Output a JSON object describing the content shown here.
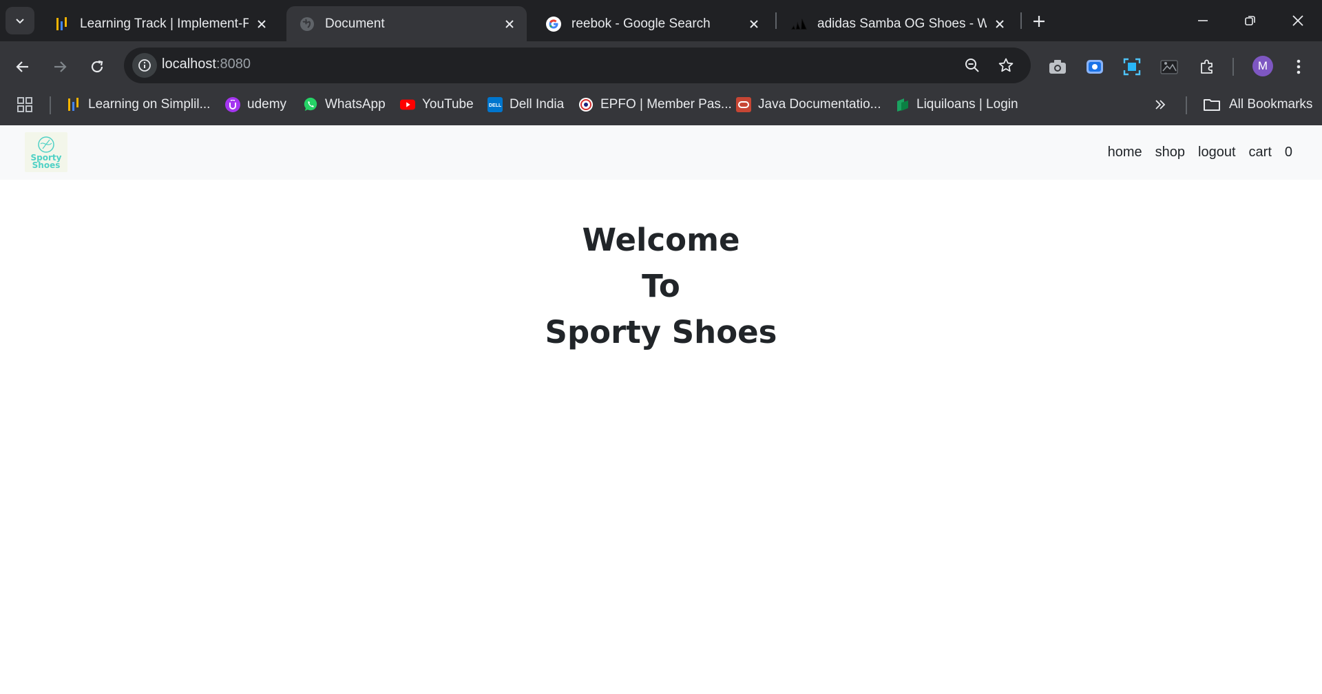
{
  "browser": {
    "tabs": [
      {
        "title": "Learning Track | Implement-Fran",
        "icon": "simplilearn-icon",
        "active": false
      },
      {
        "title": "Document",
        "icon": "globe-icon",
        "active": true
      },
      {
        "title": "reebok - Google Search",
        "icon": "google-icon",
        "active": false
      },
      {
        "title": "adidas Samba OG Shoes - White",
        "icon": "adidas-icon",
        "active": false
      }
    ],
    "address": {
      "host": "localhost",
      "port": ":8080"
    },
    "profile_initial": "M",
    "bookmarks": [
      {
        "label": "Learning on Simplil...",
        "icon": "simplilearn-icon",
        "color": "#f4b400"
      },
      {
        "label": "udemy",
        "icon": "udemy-icon",
        "color": "#a435f0"
      },
      {
        "label": "WhatsApp",
        "icon": "whatsapp-icon",
        "color": "#25d366"
      },
      {
        "label": "YouTube",
        "icon": "youtube-icon",
        "color": "#ff0000"
      },
      {
        "label": "Dell India",
        "icon": "dell-icon",
        "color": "#0076ce"
      },
      {
        "label": "EPFO | Member Pas...",
        "icon": "epfo-icon",
        "color": "#d32f2f"
      },
      {
        "label": "Java Documentatio...",
        "icon": "oracle-icon",
        "color": "#c74634"
      },
      {
        "label": "Liquiloans | Login",
        "icon": "liquiloans-icon",
        "color": "#1aa260"
      }
    ],
    "all_bookmarks_label": "All Bookmarks"
  },
  "site": {
    "logo_text": [
      "Sporty",
      "Shoes"
    ],
    "nav": {
      "home": "home",
      "shop": "shop",
      "logout": "logout",
      "cart": "cart",
      "cart_count": "0"
    },
    "welcome": [
      "Welcome",
      "To",
      "Sporty Shoes"
    ]
  },
  "colors": {
    "chrome_dark": "#202124",
    "chrome": "#35363a",
    "nav_bg": "#f8f9fa",
    "text": "#212529",
    "logo_accent": "#4fd1c5"
  }
}
